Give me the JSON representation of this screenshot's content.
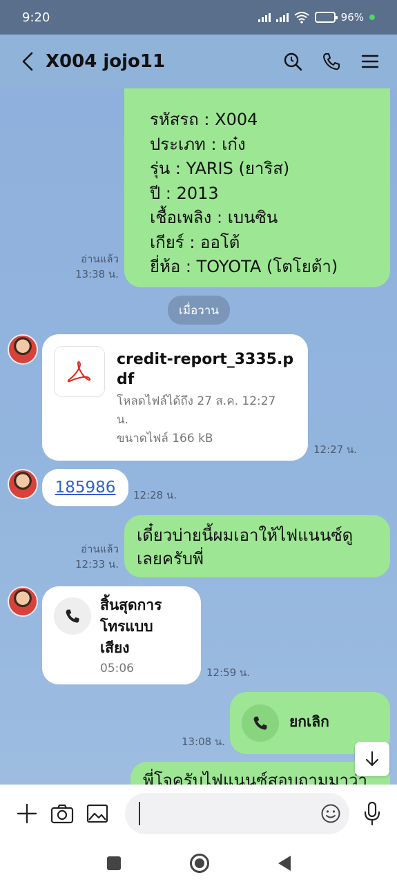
{
  "status": {
    "time": "9:20",
    "battery": "96%"
  },
  "header": {
    "title": "X004 jojo11"
  },
  "car_info": {
    "lines": [
      "รหัสรถ : X004",
      "ประเภท : เก๋ง",
      "รุ่น : YARIS (ยาริส)",
      "ปี : 2013",
      "เชื้อเพลิง : เบนซิน",
      "เกียร์ : ออโต้",
      "ยี่ห้อ : TOYOTA (โตโยต้า)"
    ],
    "read": "อ่านแล้ว",
    "time": "13:38 น."
  },
  "date_divider": "เมื่อวาน",
  "file_msg": {
    "name": "credit-report_3335.pdf",
    "expiry_line1": "โหลดไฟล์ได้ถึง 27 ส.ค. 12:27",
    "expiry_line2": "น.",
    "size": "ขนาดไฟล์ 166 kB",
    "time": "12:27 น."
  },
  "code_msg": {
    "text": "185986",
    "time": "12:28 น."
  },
  "sent_msg": {
    "line1": "เดี๋ยวบ่ายนี้ผมเอาให้ไฟแนนซ์ดู",
    "line2": "เลยครับพี่",
    "read": "อ่านแล้ว",
    "time": "12:33 น."
  },
  "call_ended": {
    "line1": "สิ้นสุดการ",
    "line2": "โทรแบบ",
    "line3": "เสียง",
    "duration": "05:06",
    "time": "12:59 น."
  },
  "call_cancel": {
    "label": "ยกเลิก",
    "time": "13:08 น."
  },
  "partial_msg": {
    "text": "พี่โจครับไฟแนนซ์สอบถามมาว่า"
  },
  "input": {
    "placeholder": ""
  },
  "colors": {
    "bubble_green": "#9de693",
    "chat_bg": "#8fb3d9",
    "link": "#2f5fd0"
  }
}
